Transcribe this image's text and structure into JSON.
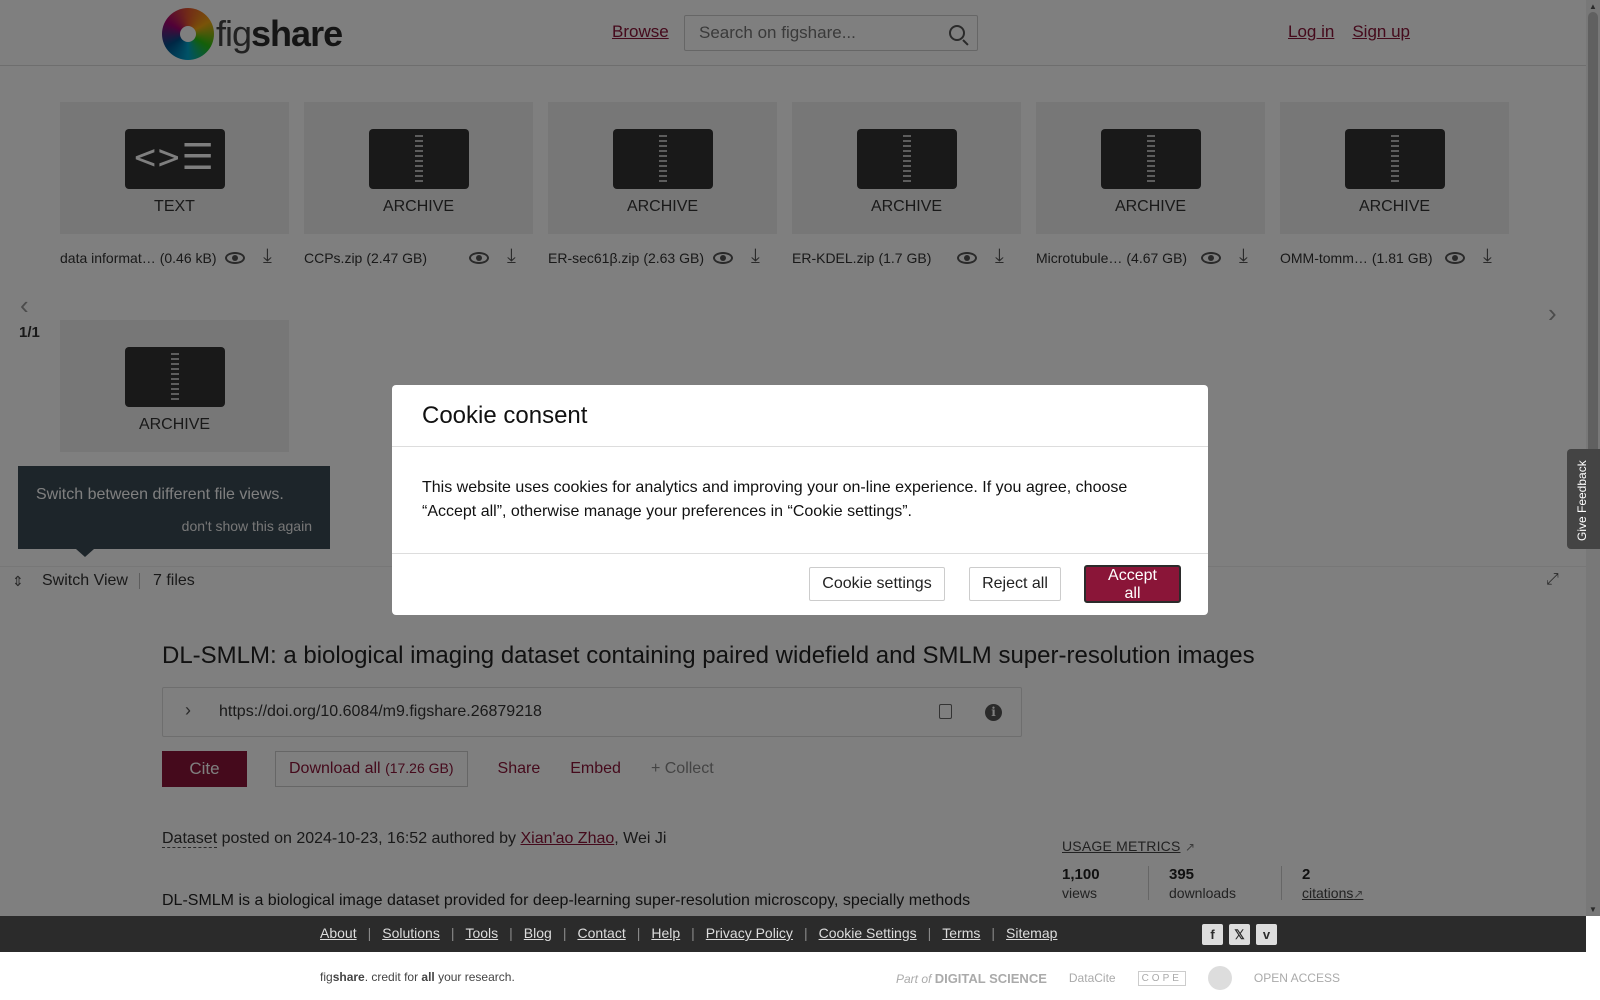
{
  "header": {
    "logo_text_light": "fig",
    "logo_text_bold": "share",
    "browse_label": "Browse",
    "search_placeholder": "Search on figshare...",
    "login_label": "Log in",
    "signup_label": "Sign up"
  },
  "file_tiles": [
    {
      "type": "TEXT",
      "icon": "code-file-icon"
    },
    {
      "type": "ARCHIVE",
      "icon": "zip-archive-icon"
    },
    {
      "type": "ARCHIVE",
      "icon": "zip-archive-icon"
    },
    {
      "type": "ARCHIVE",
      "icon": "zip-archive-icon"
    },
    {
      "type": "ARCHIVE",
      "icon": "zip-archive-icon"
    },
    {
      "type": "ARCHIVE",
      "icon": "zip-archive-icon"
    },
    {
      "type": "ARCHIVE",
      "icon": "zip-archive-icon"
    }
  ],
  "code_glyph": "<>☰",
  "files": [
    {
      "name": "data informat…",
      "size": "(0.46 kB)"
    },
    {
      "name": "CCPs.zip",
      "size": "(2.47 GB)"
    },
    {
      "name": "ER-sec61β.zip",
      "size": "(2.63 GB)"
    },
    {
      "name": "ER-KDEL.zip",
      "size": "(1.7 GB)"
    },
    {
      "name": "Microtubule…",
      "size": "(4.67 GB)"
    },
    {
      "name": "OMM-tomm…",
      "size": "(1.81 GB)"
    }
  ],
  "pager": {
    "prev": "‹",
    "count": "1/1",
    "next": "›"
  },
  "tooltip": {
    "text": "Switch between different file views.",
    "dismiss": "don't show this again"
  },
  "viewbar": {
    "switch_label": "Switch View",
    "files_count": "7 files"
  },
  "item": {
    "title": "DL-SMLM: a biological imaging dataset containing paired widefield and SMLM super-resolution images",
    "doi": "https://doi.org/10.6084/m9.figshare.26879218",
    "cite_label": "Cite",
    "download_label": "Download all",
    "download_size": "(17.26 GB)",
    "share_label": "Share",
    "embed_label": "Embed",
    "collect_label": "+ Collect",
    "dataset_label": "Dataset",
    "posted_text": " posted on 2024-10-23, 16:52 authored by ",
    "author_1": "Xian'ao Zhao",
    "author_sep": ", ",
    "author_2": "Wei Ji",
    "description": "DL-SMLM is a biological image dataset provided for deep-learning super-resolution microscopy, specially methods"
  },
  "metrics": {
    "title": "USAGE METRICS",
    "views_value": "1,100",
    "views_label": "views",
    "downloads_value": "395",
    "downloads_label": "downloads",
    "citations_value": "2",
    "citations_label": "citations"
  },
  "footer": {
    "links": [
      "About",
      "Solutions",
      "Tools",
      "Blog",
      "Contact",
      "Help",
      "Privacy Policy",
      "Cookie Settings",
      "Terms",
      "Sitemap"
    ],
    "social": [
      "f",
      "𝕏",
      "v"
    ],
    "tagline_fig": "fig",
    "tagline_share": "share",
    "tagline_mid": ". credit for ",
    "tagline_all": "all",
    "tagline_end": " your research.",
    "partner_part_of": "Part of ",
    "partner_ds": "DIGITAL SCIENCE",
    "partner_datacite": "DataCite",
    "partner_cope": "COPE",
    "partner_open_access": "OPEN ACCESS"
  },
  "feedback_label": "Give Feedback",
  "cookie_modal": {
    "title": "Cookie consent",
    "body": "This website uses cookies for analytics and improving your on-line experience. If you agree, choose “Accept all”, otherwise manage your preferences in “Cookie settings”.",
    "settings_label": "Cookie settings",
    "reject_label": "Reject all",
    "accept_label": "Accept all"
  },
  "colors": {
    "brand": "#8a1538",
    "footer": "#2b2b2b",
    "tooltip": "#3a4a55"
  }
}
